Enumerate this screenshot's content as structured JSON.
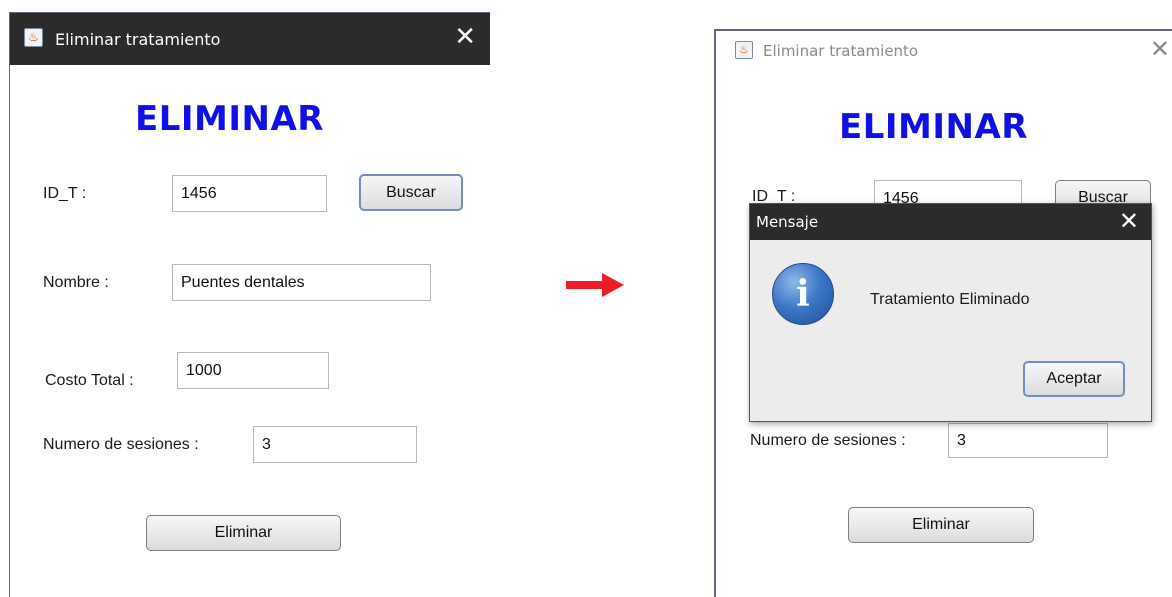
{
  "left_window": {
    "title": "Eliminar tratamiento",
    "close_glyph": "✕",
    "heading": "ELIMINAR",
    "id_label": "ID_T :",
    "id_value": "1456",
    "buscar_label": "Buscar",
    "nombre_label": "Nombre :",
    "nombre_value": "Puentes dentales",
    "costo_label": "Costo Total :",
    "costo_value": "1000",
    "sesiones_label": "Numero de sesiones :",
    "sesiones_value": "3",
    "eliminar_label": "Eliminar"
  },
  "right_window": {
    "title": "Eliminar tratamiento",
    "close_glyph": "✕",
    "heading": "ELIMINAR",
    "id_label": "ID_T :",
    "id_value": "1456",
    "buscar_label": "Buscar",
    "sesiones_label": "Numero de sesiones :",
    "sesiones_value": "3",
    "eliminar_label": "Eliminar"
  },
  "dialog": {
    "title": "Mensaje",
    "close_glyph": "✕",
    "message": "Tratamiento Eliminado",
    "accept_label": "Aceptar",
    "icon": "info-icon"
  },
  "colors": {
    "heading": "#0f0fe6",
    "title_bar_dark": "#2b2b2b",
    "arrow": "#ee1c24",
    "window_border": "#6f5f86"
  }
}
